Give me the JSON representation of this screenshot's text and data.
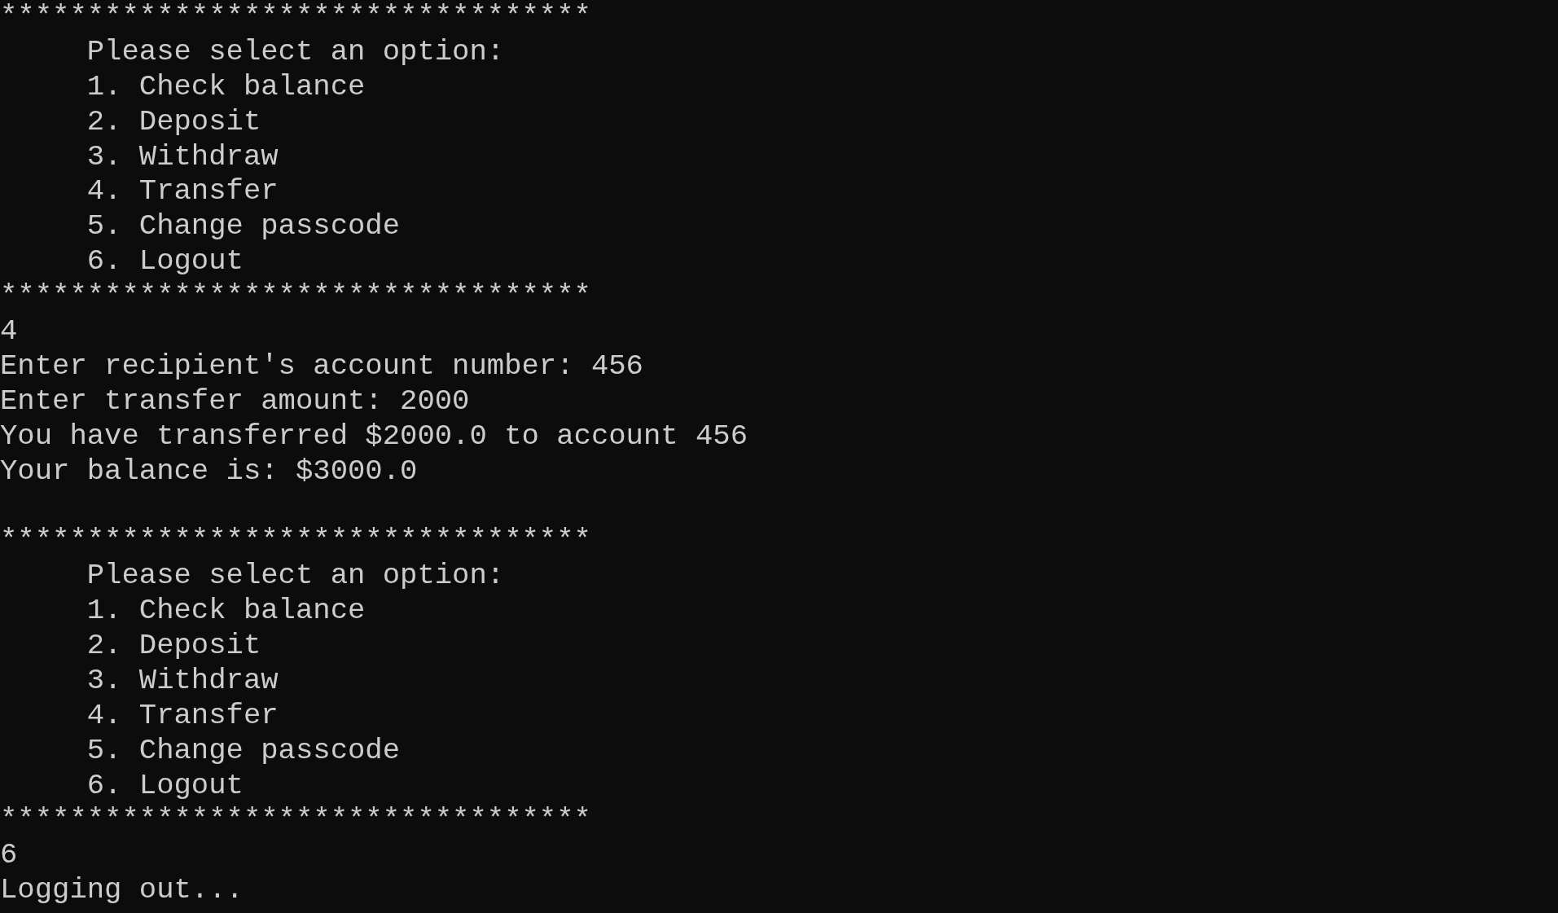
{
  "console": {
    "lines": [
      {
        "kind": "text",
        "text": "**********************************"
      },
      {
        "kind": "text",
        "text": "     Please select an option:"
      },
      {
        "kind": "text",
        "text": "     1. Check balance"
      },
      {
        "kind": "text",
        "text": "     2. Deposit"
      },
      {
        "kind": "text",
        "text": "     3. Withdraw"
      },
      {
        "kind": "text",
        "text": "     4. Transfer"
      },
      {
        "kind": "text",
        "text": "     5. Change passcode"
      },
      {
        "kind": "text",
        "text": "     6. Logout"
      },
      {
        "kind": "text",
        "text": "**********************************"
      },
      {
        "kind": "text",
        "text": "4"
      },
      {
        "kind": "text",
        "text": "Enter recipient's account number: 456"
      },
      {
        "kind": "text",
        "text": "Enter transfer amount: 2000"
      },
      {
        "kind": "text",
        "text": "You have transferred $2000.0 to account 456"
      },
      {
        "kind": "text",
        "text": "Your balance is: $3000.0"
      },
      {
        "kind": "blank"
      },
      {
        "kind": "text",
        "text": "**********************************"
      },
      {
        "kind": "text",
        "text": "     Please select an option:"
      },
      {
        "kind": "text",
        "text": "     1. Check balance"
      },
      {
        "kind": "text",
        "text": "     2. Deposit"
      },
      {
        "kind": "text",
        "text": "     3. Withdraw"
      },
      {
        "kind": "text",
        "text": "     4. Transfer"
      },
      {
        "kind": "text",
        "text": "     5. Change passcode"
      },
      {
        "kind": "text",
        "text": "     6. Logout"
      },
      {
        "kind": "text",
        "text": "**********************************"
      },
      {
        "kind": "text",
        "text": "6"
      },
      {
        "kind": "text",
        "text": "Logging out..."
      }
    ]
  }
}
